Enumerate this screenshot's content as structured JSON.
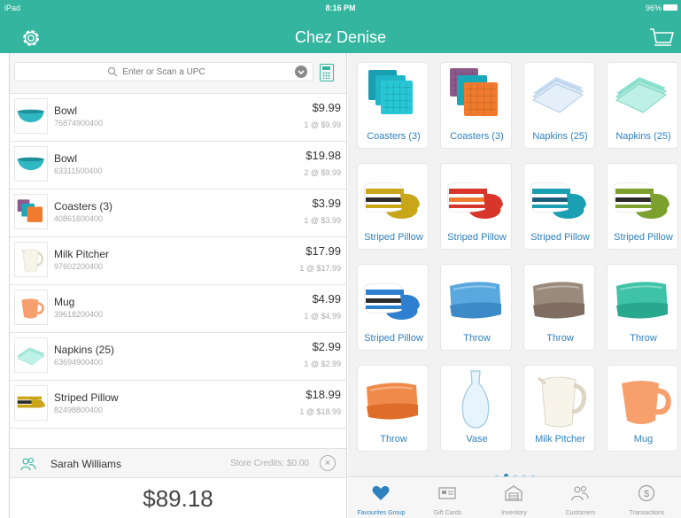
{
  "status_bar": {
    "device": "iPad",
    "time": "8:16 PM",
    "battery": "96%"
  },
  "header": {
    "title": "Chez Denise"
  },
  "search": {
    "placeholder": "Enter or Scan a UPC"
  },
  "line_items": [
    {
      "name": "Bowl",
      "sku": "76874900400",
      "total": "$9.99",
      "qty": "1 @ $9.99",
      "thumb": "bowl"
    },
    {
      "name": "Bowl",
      "sku": "63311500400",
      "total": "$19.98",
      "qty": "2 @ $9.99",
      "thumb": "bowl"
    },
    {
      "name": "Coasters (3)",
      "sku": "40861600400",
      "total": "$3.99",
      "qty": "1 @ $3.99",
      "thumb": "coasters"
    },
    {
      "name": "Milk Pitcher",
      "sku": "97602200400",
      "total": "$17.99",
      "qty": "1 @ $17.99",
      "thumb": "pitcher"
    },
    {
      "name": "Mug",
      "sku": "39618200400",
      "total": "$4.99",
      "qty": "1 @ $4.99",
      "thumb": "mug"
    },
    {
      "name": "Napkins (25)",
      "sku": "63694900400",
      "total": "$2.99",
      "qty": "1 @ $2.99",
      "thumb": "napkins"
    },
    {
      "name": "Striped Pillow",
      "sku": "82498800400",
      "total": "$18.99",
      "qty": "1 @ $18.99",
      "thumb": "pillow"
    }
  ],
  "customer": {
    "name": "Sarah Williams",
    "store_credits": "Store Credits: $0.00"
  },
  "order": {
    "total": "$89.18"
  },
  "product_grid": [
    {
      "label": "Coasters (3)",
      "image": "coasters-teal"
    },
    {
      "label": "Coasters (3)",
      "image": "coasters-mixed"
    },
    {
      "label": "Napkins (25)",
      "image": "napkins-blue"
    },
    {
      "label": "Napkins (25)",
      "image": "napkins-mint"
    },
    {
      "label": "Striped Pillow",
      "image": "pillow-yellow"
    },
    {
      "label": "Striped Pillow",
      "image": "pillow-red"
    },
    {
      "label": "Striped Pillow",
      "image": "pillow-teal"
    },
    {
      "label": "Striped Pillow",
      "image": "pillow-green"
    },
    {
      "label": "Striped Pillow",
      "image": "pillow-blue"
    },
    {
      "label": "Throw",
      "image": "throw-blue"
    },
    {
      "label": "Throw",
      "image": "throw-brown"
    },
    {
      "label": "Throw",
      "image": "throw-teal"
    },
    {
      "label": "Throw",
      "image": "throw-orange"
    },
    {
      "label": "Vase",
      "image": "vase"
    },
    {
      "label": "Milk Pitcher",
      "image": "pitcher"
    },
    {
      "label": "Mug",
      "image": "mug"
    }
  ],
  "pager": {
    "pages": 5,
    "current": 2
  },
  "tabs": [
    {
      "label": "Favourites Group",
      "icon": "heart-icon",
      "active": true
    },
    {
      "label": "Gift Cards",
      "icon": "gift-card-icon",
      "active": false
    },
    {
      "label": "Inventory",
      "icon": "warehouse-icon",
      "active": false
    },
    {
      "label": "Customers",
      "icon": "customers-icon",
      "active": false
    },
    {
      "label": "Transactions",
      "icon": "dollar-circle-icon",
      "active": false
    }
  ],
  "colors": {
    "header": "#33b5a0",
    "link": "#2e80bf",
    "panel": "#f2f2f2"
  }
}
